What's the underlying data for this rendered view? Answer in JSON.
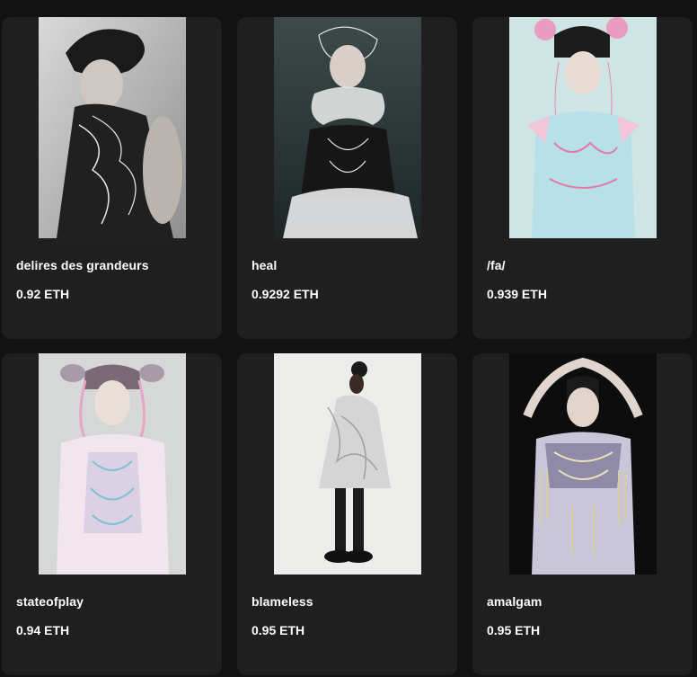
{
  "items": [
    {
      "title": "delires des grandeurs",
      "price": "0.92 ETH",
      "image": "portrait-black-ruffled-dress"
    },
    {
      "title": "heal",
      "price": "0.9292 ETH",
      "image": "portrait-wire-headpiece-dark-dress"
    },
    {
      "title": "/fa/",
      "price": "0.939 ETH",
      "image": "portrait-pastel-embroidered-dress"
    },
    {
      "title": "stateofplay",
      "price": "0.94 ETH",
      "image": "portrait-pigtails-pastel-dress"
    },
    {
      "title": "blameless",
      "price": "0.95 ETH",
      "image": "fullbody-translucent-dress"
    },
    {
      "title": "amalgam",
      "price": "0.95 ETH",
      "image": "portrait-armored-fringe-dress"
    }
  ],
  "colors": {
    "background": "#121212",
    "card": "#1f1f1f",
    "text": "#ffffff"
  }
}
